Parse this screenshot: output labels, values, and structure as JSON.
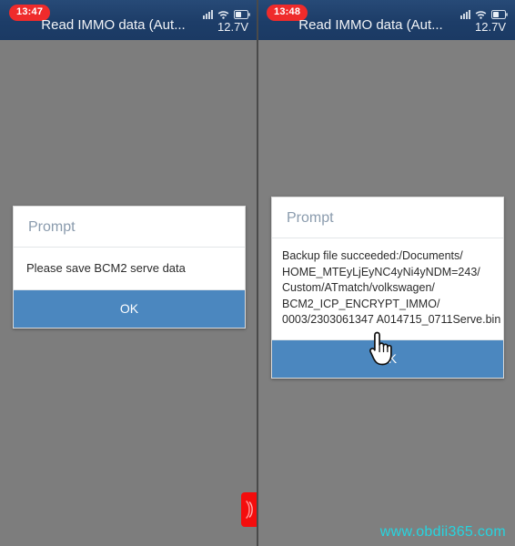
{
  "panels": [
    {
      "id": "left",
      "statusbar": {
        "time": "13:47",
        "title": "Read IMMO data (Aut...",
        "voltage": "12.7V",
        "icons": {
          "signal": "signal-bars-icon",
          "wifi": "wifi-icon",
          "battery": "battery-icon"
        }
      },
      "dialog": {
        "title": "Prompt",
        "message": "Please save BCM2 serve data",
        "button_label": "OK"
      },
      "red_tab": "floating-toolbar-tab-icon"
    },
    {
      "id": "right",
      "statusbar": {
        "time": "13:48",
        "title": "Read IMMO data (Aut...",
        "voltage": "12.7V",
        "icons": {
          "signal": "signal-bars-icon",
          "wifi": "wifi-icon",
          "battery": "battery-icon"
        }
      },
      "dialog": {
        "title": "Prompt",
        "message_lines": [
          "Backup file succeeded:/Documents/",
          "HOME_MTEyLjEyNC4yNi4yNDM=243/",
          "Custom/ATmatch/volkswagen/",
          "BCM2_ICP_ENCRYPT_IMMO/",
          "0003/2303061347 A014715_0711Serve.bin"
        ],
        "button_label": "OK"
      },
      "cursor": "hand-pointer-cursor"
    }
  ],
  "watermark": "www.obdii365.com",
  "colors": {
    "titlebar": "#1d3d68",
    "time_badge": "#ef2b2b",
    "dialog_button": "#4b87bf",
    "dialog_title_text": "#8a9bad",
    "background": "#7d7d7d",
    "watermark": "#25d5e0",
    "red_tab": "#f40d0d"
  }
}
